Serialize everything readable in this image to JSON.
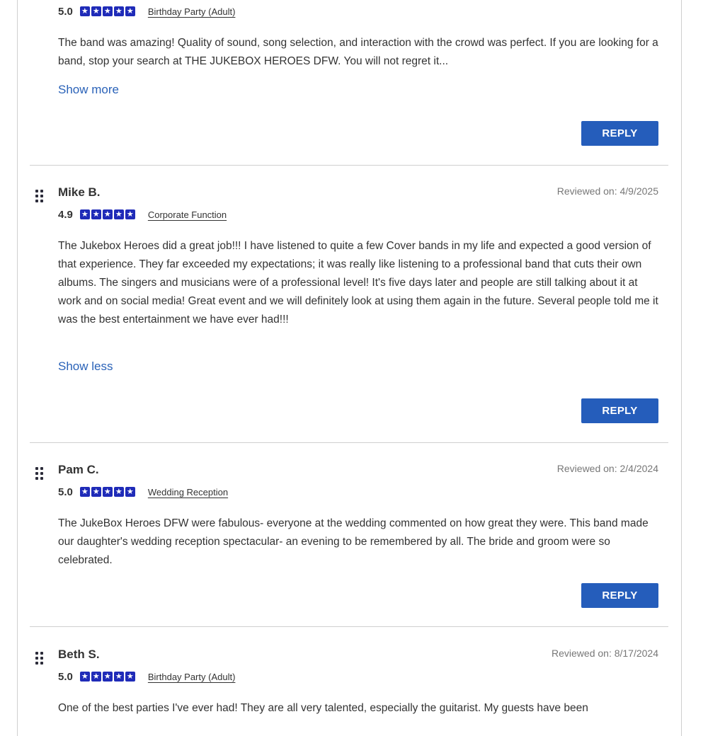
{
  "reviews": [
    {
      "name": "",
      "date": "",
      "score": "5.0",
      "stars": 5,
      "event": "Birthday Party (Adult)",
      "text": "The band was amazing! Quality of sound, song selection, and interaction with the crowd was perfect. If you are looking for a band, stop your search at THE JUKEBOX HEROES DFW. You will not regret it...",
      "toggle": "Show more",
      "reply": "REPLY"
    },
    {
      "name": "Mike B.",
      "date": "Reviewed on: 4/9/2025",
      "score": "4.9",
      "stars": 5,
      "event": "Corporate Function",
      "text": "The Jukebox Heroes did a great job!!! I have listened to quite a few Cover bands in my life and expected a good version of that experience. They far exceeded my expectations; it was really like listening to a professional band that cuts their own albums. The singers and musicians were of a professional level! It's five days later and people are still talking about it at work and on social media! Great event and we will definitely look at using them again in the future. Several people told me it was the best entertainment we have ever had!!!",
      "toggle": "Show less",
      "reply": "REPLY"
    },
    {
      "name": "Pam C.",
      "date": "Reviewed on: 2/4/2024",
      "score": "5.0",
      "stars": 5,
      "event": "Wedding Reception",
      "text": "The JukeBox Heroes DFW were fabulous- everyone at the wedding commented on how great they were. This band made our daughter's wedding reception spectacular- an evening to be remembered by all. The bride and groom were so celebrated.",
      "reply": "REPLY"
    },
    {
      "name": "Beth S.",
      "date": "Reviewed on: 8/17/2024",
      "score": "5.0",
      "stars": 5,
      "event": "Birthday Party (Adult)",
      "text": "One of the best parties I've ever had! They are all very talented, especially the guitarist. My guests have been"
    }
  ],
  "colors": {
    "star": "#1f2bb8",
    "link": "#2a62b8",
    "button": "#255dbb"
  }
}
